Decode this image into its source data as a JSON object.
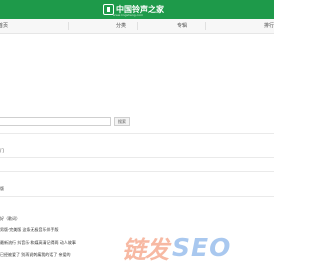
{
  "header": {
    "logo_text": "中国铃声之家",
    "logo_subtext": "www.lingsheng.com"
  },
  "nav": {
    "items": [
      {
        "label": "首页"
      },
      {
        "label": "分类"
      },
      {
        "label": "专辑"
      },
      {
        "label": "排行"
      }
    ]
  },
  "search": {
    "placeholder": "",
    "button_label": "搜索"
  },
  "lines": [
    "门",
    "版",
    "好（歌词）",
    "男版·完美版 这条无极音乐伴手版",
    "最新流行 抖音乐·和媒高清记得两 动人故事",
    "已经被爱了 别再说刺痛我的话了 亲爱的"
  ],
  "watermark": {
    "cn": "链发",
    "en": "SEO"
  }
}
